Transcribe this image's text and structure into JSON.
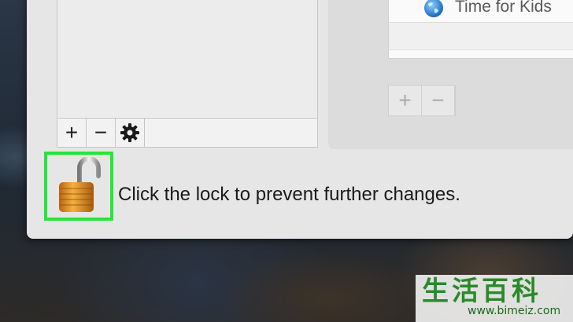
{
  "left_toolbar": {
    "add_label": "+",
    "remove_label": "−"
  },
  "right_panel": {
    "list_items": [
      "Time for Kids"
    ],
    "add_label": "+",
    "remove_label": "−"
  },
  "lock": {
    "message": "Click the lock to prevent further changes.",
    "icon": "unlocked-padlock-icon",
    "highlight_color": "#22e63a"
  },
  "watermark": {
    "logo_text": "生活百科",
    "url": "www.bimeiz.com"
  }
}
